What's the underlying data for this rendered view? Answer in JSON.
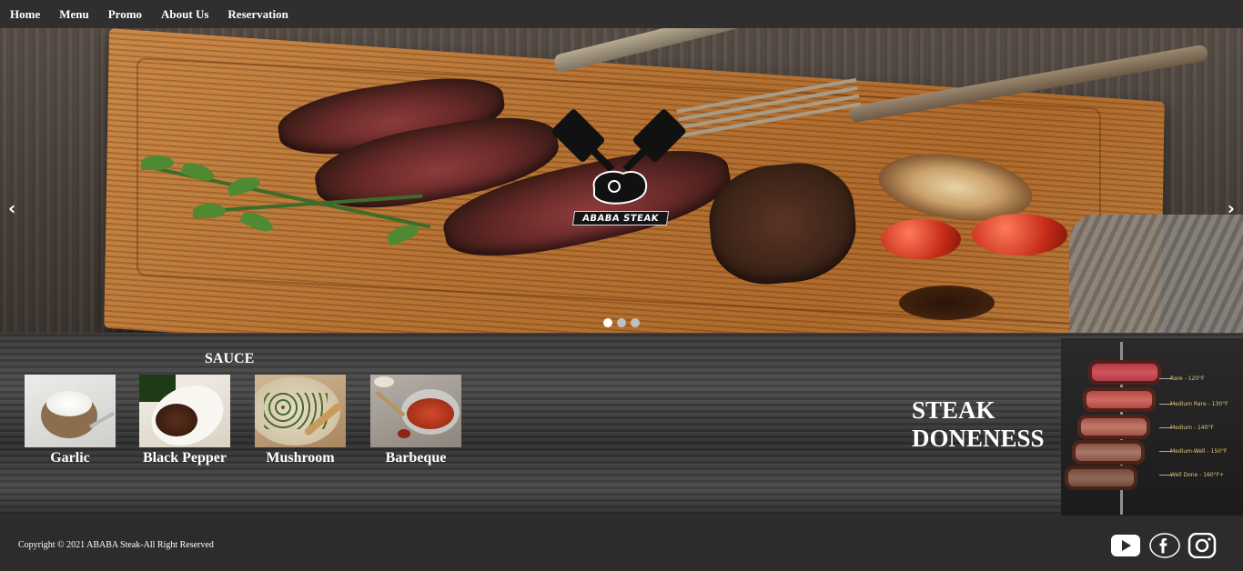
{
  "nav": {
    "items": [
      "Home",
      "Menu",
      "Promo",
      "About Us",
      "Reservation"
    ]
  },
  "hero": {
    "logo_text": "ABABA STEAK",
    "prev_glyph": "‹",
    "next_glyph": "›",
    "slide_count": 3,
    "active_slide": 1
  },
  "sauce": {
    "title": "SAUCE",
    "items": [
      {
        "label": "Garlic"
      },
      {
        "label": "Black Pepper"
      },
      {
        "label": "Mushroom"
      },
      {
        "label": "Barbeque"
      }
    ]
  },
  "doneness": {
    "title_line1": "STEAK",
    "title_line2": "DONENESS",
    "levels": [
      "Rare - 120°F",
      "Medium Rare - 130°F",
      "Medium - 140°F",
      "Medium-Well - 150°F",
      "Well Done - 160°F+"
    ]
  },
  "footer": {
    "copyright": "Copyright © 2021 ABABA Steak-All Right Reserved",
    "social": [
      "youtube-icon",
      "facebook-icon",
      "instagram-icon"
    ]
  },
  "colors": {
    "nav_bg": "#2f2f2f",
    "footer_bg": "#2c2c2c",
    "text": "#ffffff"
  }
}
